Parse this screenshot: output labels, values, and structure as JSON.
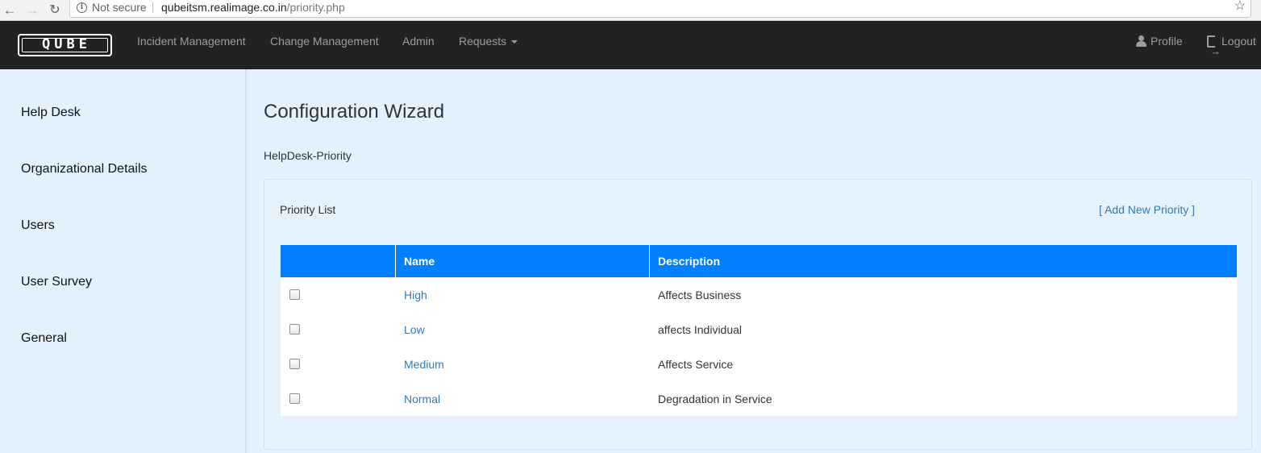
{
  "browser": {
    "security_label": "Not secure",
    "url_host": "qubeitsm.realimage.co.in",
    "url_path": "/priority.php"
  },
  "navbar": {
    "logo_text": "QUBE",
    "links": {
      "incident": "Incident Management",
      "change": "Change Management",
      "admin": "Admin",
      "requests": "Requests"
    },
    "profile": "Profile",
    "logout": "Logout"
  },
  "sidebar": {
    "items": [
      "Help Desk",
      "Organizational Details",
      "Users",
      "User Survey",
      "General"
    ]
  },
  "main": {
    "title": "Configuration Wizard",
    "subtitle": "HelpDesk-Priority",
    "panel_title": "Priority List",
    "add_link": "[ Add New Priority ]",
    "table": {
      "headers": [
        "",
        "Name",
        "Description"
      ],
      "rows": [
        {
          "name": "High",
          "description": "Affects Business"
        },
        {
          "name": "Low",
          "description": "affects Individual"
        },
        {
          "name": "Medium",
          "description": "Affects Service"
        },
        {
          "name": "Normal",
          "description": "Degradation in Service"
        }
      ]
    }
  },
  "colors": {
    "navbar_bg": "#222222",
    "table_header_bg": "#0080ff",
    "link": "#337ab7",
    "page_bg": "#e3f1fc"
  }
}
